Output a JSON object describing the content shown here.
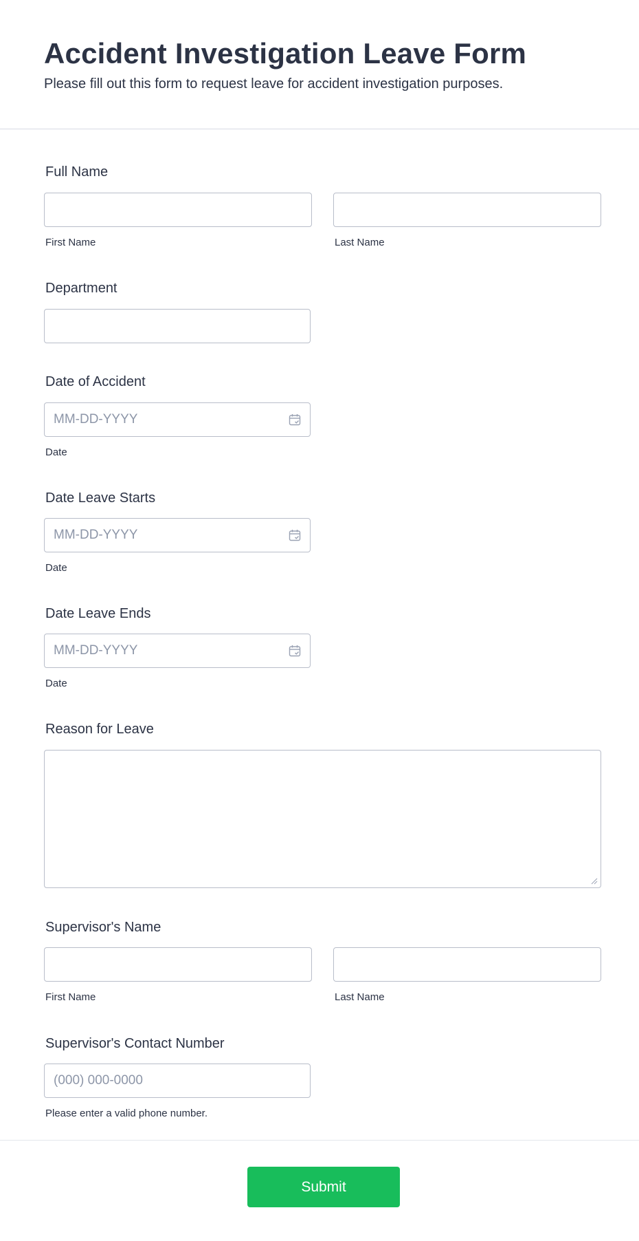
{
  "form": {
    "title": "Accident Investigation Leave Form",
    "subtitle": "Please fill out this form to request leave for accident investigation purposes."
  },
  "full_name": {
    "label": "Full Name",
    "first_sublabel": "First Name",
    "last_sublabel": "Last Name",
    "first_value": "",
    "last_value": ""
  },
  "department": {
    "label": "Department",
    "value": ""
  },
  "date_of_accident": {
    "label": "Date of Accident",
    "placeholder": "MM-DD-YYYY",
    "sublabel": "Date"
  },
  "date_leave_starts": {
    "label": "Date Leave Starts",
    "placeholder": "MM-DD-YYYY",
    "sublabel": "Date"
  },
  "date_leave_ends": {
    "label": "Date Leave Ends",
    "placeholder": "MM-DD-YYYY",
    "sublabel": "Date"
  },
  "reason": {
    "label": "Reason for Leave",
    "value": ""
  },
  "supervisor_name": {
    "label": "Supervisor's Name",
    "first_sublabel": "First Name",
    "last_sublabel": "Last Name",
    "first_value": "",
    "last_value": ""
  },
  "supervisor_contact": {
    "label": "Supervisor's Contact Number",
    "placeholder": "(000) 000-0000",
    "sublabel": "Please enter a valid phone number."
  },
  "submit": {
    "label": "Submit"
  },
  "icons": {
    "calendar": "calendar-icon",
    "resize": "resize-handle-icon"
  },
  "colors": {
    "text": "#2c3345",
    "placeholder": "#8d96a8",
    "border": "#b8bdc9",
    "submit": "#18bd5b"
  }
}
